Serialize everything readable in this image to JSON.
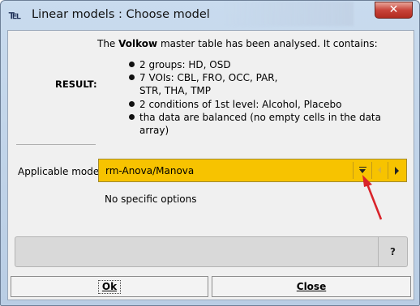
{
  "window": {
    "title": "Linear models : Choose model",
    "app_icon": "pmod-logo-icon",
    "close_label": "✕"
  },
  "analysis": {
    "intro_prefix": "The ",
    "intro_table": "Volkow",
    "intro_suffix": " master table has been analysed. It contains:",
    "result_label": "RESULT:",
    "items": [
      "2 groups: HD, OSD",
      "7 VOIs: CBL, FRO, OCC, PAR, STR, THA, TMP",
      "2 conditions of 1st level: Alcohol, Placebo",
      "tha data are balanced (no empty cells in the data array)"
    ]
  },
  "model": {
    "label": "Applicable model",
    "selected": "rm-Anova/Manova",
    "options_text": "No specific options"
  },
  "status": {
    "help_label": "?"
  },
  "buttons": {
    "ok": "Ok",
    "close": "Close"
  },
  "colors": {
    "combo_highlight": "#f7c300",
    "pointer_arrow": "#d9242b"
  }
}
